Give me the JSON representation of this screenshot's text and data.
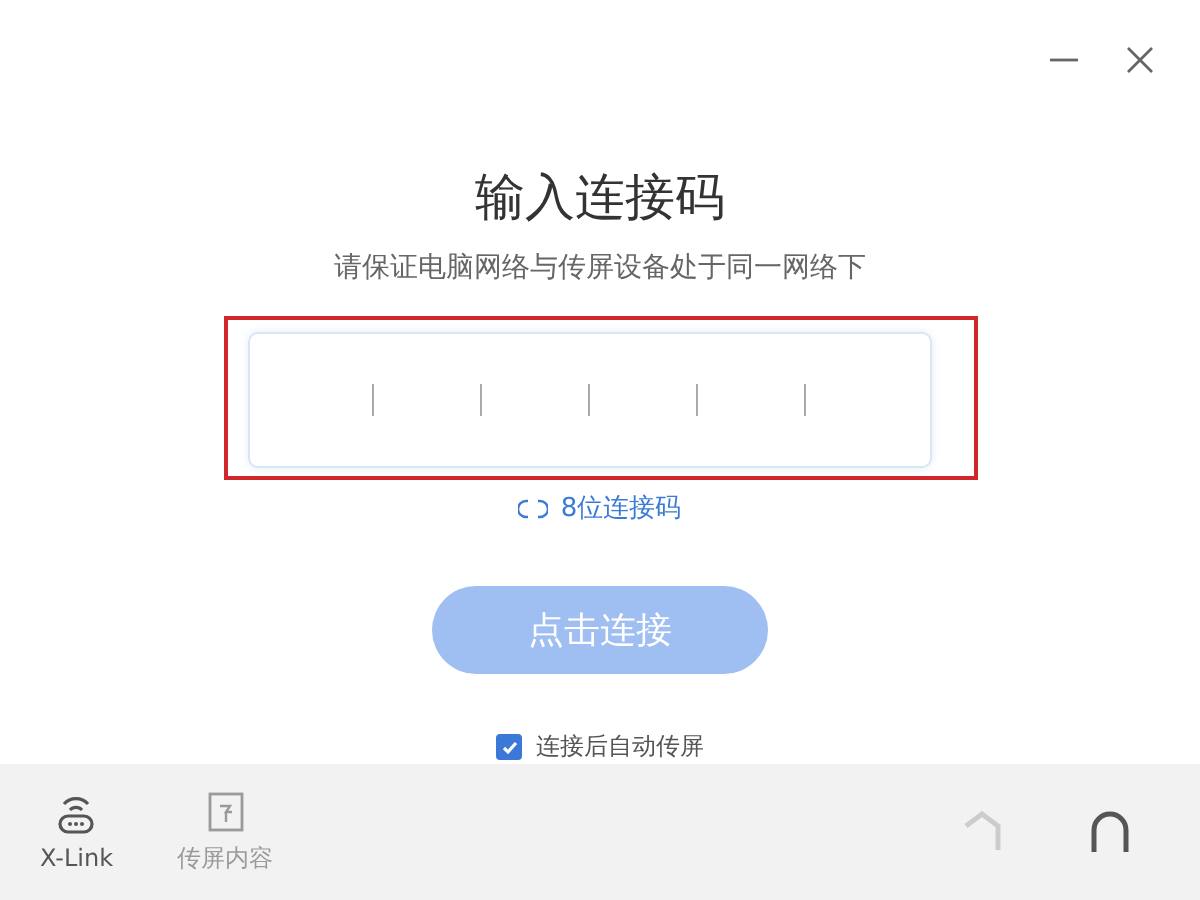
{
  "title": "输入连接码",
  "subtitle": "请保证电脑网络与传屏设备处于同一网络下",
  "switch_link": "8位连接码",
  "connect_button": {
    "label": "点击连接",
    "disabled": true
  },
  "auto_cast": {
    "label": "连接后自动传屏",
    "checked": true
  },
  "nav": [
    {
      "label": "X-Link",
      "selected": true,
      "kind": "router"
    },
    {
      "label": "传屏内容",
      "selected": false,
      "kind": "screen"
    }
  ]
}
